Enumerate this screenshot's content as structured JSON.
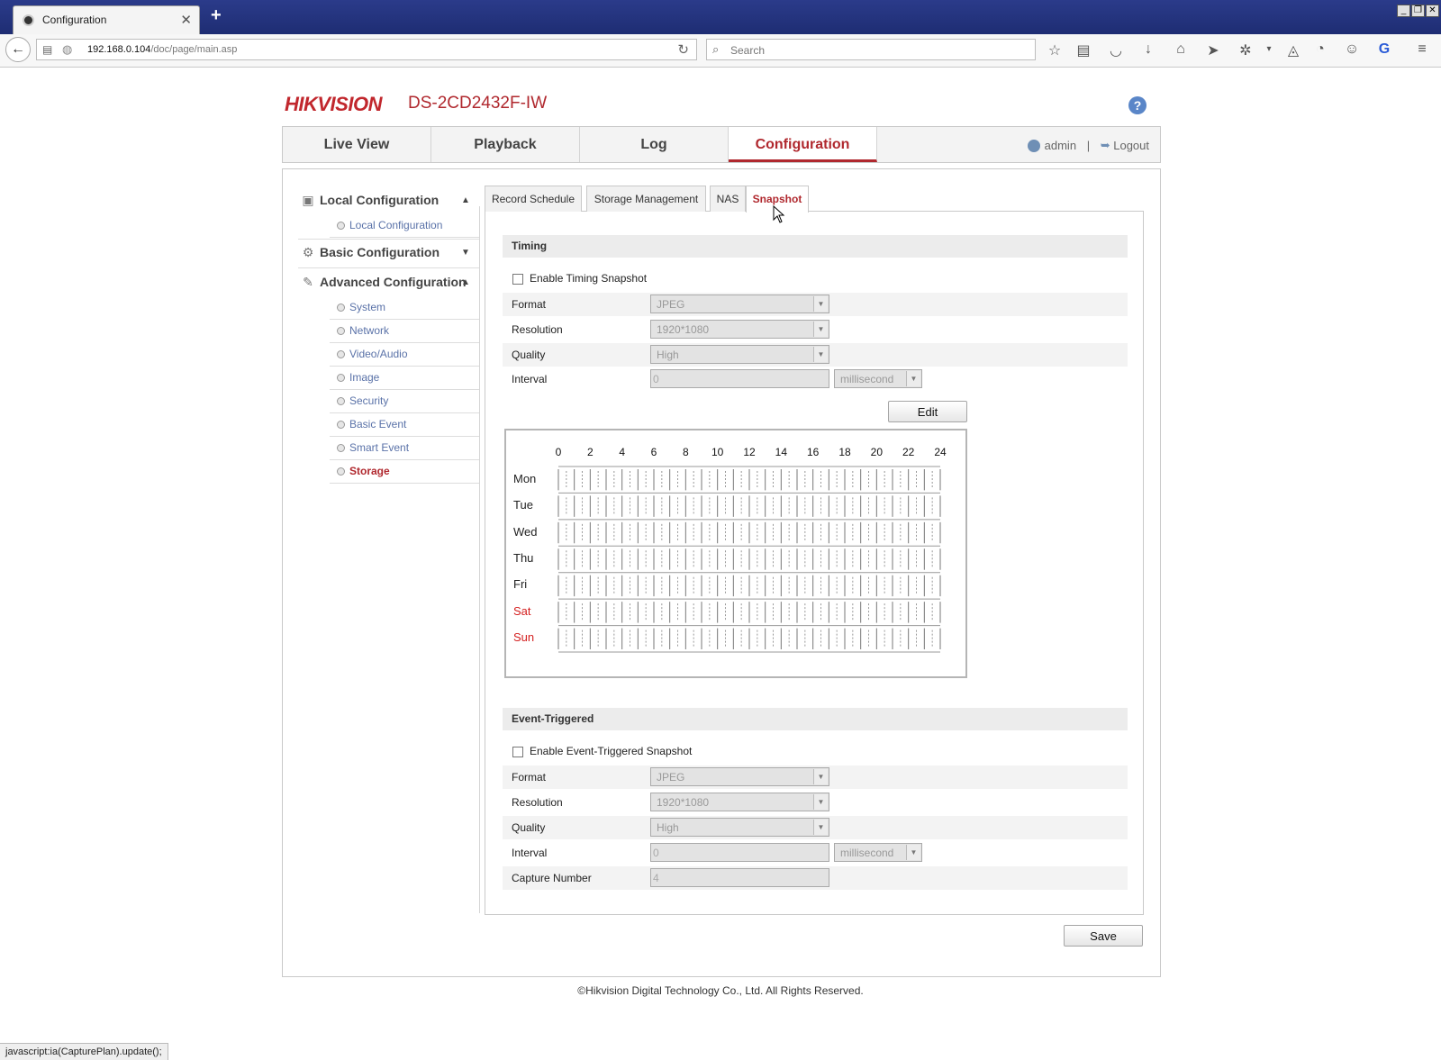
{
  "browser": {
    "tab_title": "Configuration",
    "url_host": "192.168.0.104",
    "url_path": "/doc/page/main.asp",
    "search_placeholder": "Search",
    "status_text": "javascript:ia(CapturePlan).update();"
  },
  "header": {
    "logo": "HIKVISION",
    "model": "DS-2CD2432F-IW",
    "help_icon": "?"
  },
  "main_nav": {
    "tabs": [
      {
        "label": "Live View"
      },
      {
        "label": "Playback"
      },
      {
        "label": "Log"
      },
      {
        "label": "Configuration",
        "active": true
      }
    ],
    "user": "admin",
    "logout": "Logout"
  },
  "sidebar": {
    "local_configuration": {
      "label": "Local Configuration",
      "items": [
        "Local Configuration"
      ]
    },
    "basic_configuration": {
      "label": "Basic Configuration"
    },
    "advanced_configuration": {
      "label": "Advanced Configuration",
      "items": [
        "System",
        "Network",
        "Video/Audio",
        "Image",
        "Security",
        "Basic Event",
        "Smart Event",
        "Storage"
      ],
      "active": "Storage"
    }
  },
  "sub_tabs": [
    "Record Schedule",
    "Storage Management",
    "NAS",
    "Snapshot"
  ],
  "timing": {
    "title": "Timing",
    "enable_label": "Enable Timing Snapshot",
    "format_label": "Format",
    "format_value": "JPEG",
    "resolution_label": "Resolution",
    "resolution_value": "1920*1080",
    "quality_label": "Quality",
    "quality_value": "High",
    "interval_label": "Interval",
    "interval_value": "0",
    "interval_unit": "millisecond",
    "edit_label": "Edit"
  },
  "schedule": {
    "hours": [
      "0",
      "2",
      "4",
      "6",
      "8",
      "10",
      "12",
      "14",
      "16",
      "18",
      "20",
      "22",
      "24"
    ],
    "days": [
      {
        "label": "Mon",
        "weekend": false
      },
      {
        "label": "Tue",
        "weekend": false
      },
      {
        "label": "Wed",
        "weekend": false
      },
      {
        "label": "Thu",
        "weekend": false
      },
      {
        "label": "Fri",
        "weekend": false
      },
      {
        "label": "Sat",
        "weekend": true
      },
      {
        "label": "Sun",
        "weekend": true
      }
    ],
    "weekend_color": "#d42020"
  },
  "event_triggered": {
    "title": "Event-Triggered",
    "enable_label": "Enable Event-Triggered Snapshot",
    "format_label": "Format",
    "format_value": "JPEG",
    "resolution_label": "Resolution",
    "resolution_value": "1920*1080",
    "quality_label": "Quality",
    "quality_value": "High",
    "interval_label": "Interval",
    "interval_value": "0",
    "interval_unit": "millisecond",
    "capture_number_label": "Capture Number",
    "capture_number_value": "4"
  },
  "save_label": "Save",
  "footer": "©Hikvision Digital Technology Co., Ltd. All Rights Reserved.",
  "colors": {
    "brand_red": "#b0282e",
    "link_blue": "#5a72a8"
  }
}
